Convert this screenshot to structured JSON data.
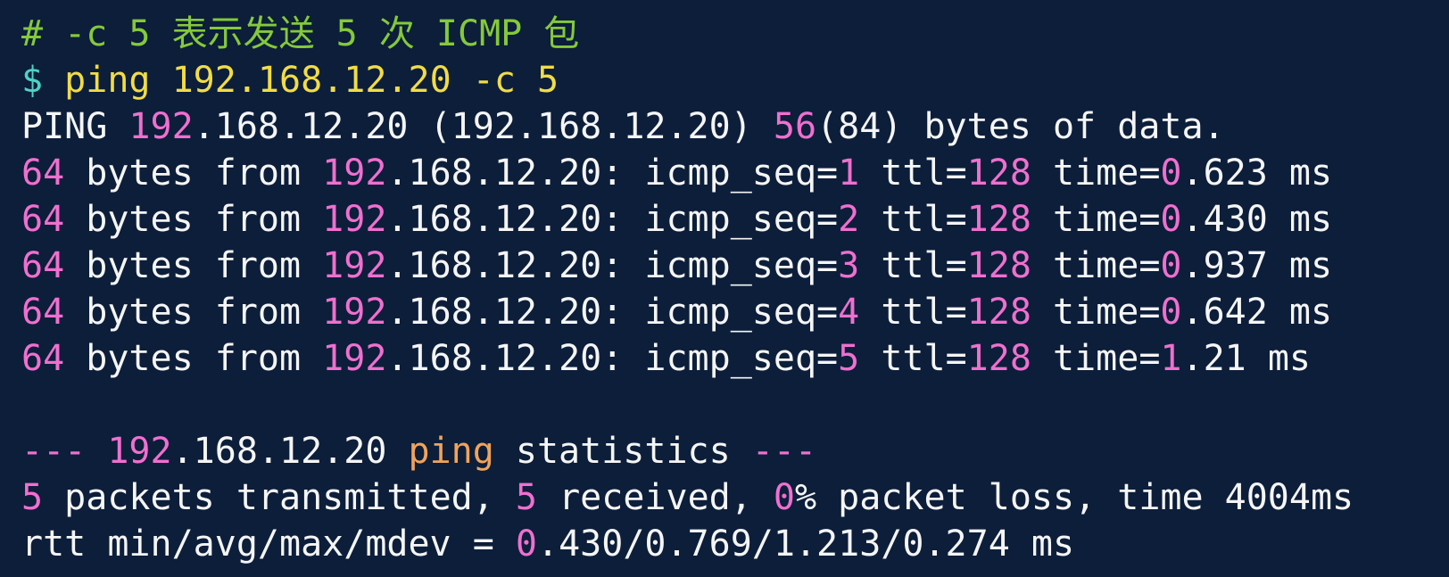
{
  "terminal": {
    "lines": [
      {
        "segments": [
          {
            "text": "# -c 5 表示发送 5 次 ICMP 包",
            "color": "green"
          }
        ]
      },
      {
        "segments": [
          {
            "text": "$ ",
            "color": "cyan"
          },
          {
            "text": "ping 192.168.12.20 -c 5",
            "color": "yellow"
          }
        ]
      },
      {
        "segments": [
          {
            "text": "PING ",
            "color": "white"
          },
          {
            "text": "192",
            "color": "pink"
          },
          {
            "text": ".168.12.20 (192.168.12.20) ",
            "color": "white"
          },
          {
            "text": "56",
            "color": "pink"
          },
          {
            "text": "(84) bytes of data.",
            "color": "white"
          }
        ]
      },
      {
        "segments": [
          {
            "text": "64",
            "color": "pink"
          },
          {
            "text": " bytes from ",
            "color": "white"
          },
          {
            "text": "192",
            "color": "pink"
          },
          {
            "text": ".168.12.20: icmp_seq=",
            "color": "white"
          },
          {
            "text": "1",
            "color": "pink"
          },
          {
            "text": " ttl=",
            "color": "white"
          },
          {
            "text": "128",
            "color": "pink"
          },
          {
            "text": " time=",
            "color": "white"
          },
          {
            "text": "0",
            "color": "pink"
          },
          {
            "text": ".623 ms",
            "color": "white"
          }
        ]
      },
      {
        "segments": [
          {
            "text": "64",
            "color": "pink"
          },
          {
            "text": " bytes from ",
            "color": "white"
          },
          {
            "text": "192",
            "color": "pink"
          },
          {
            "text": ".168.12.20: icmp_seq=",
            "color": "white"
          },
          {
            "text": "2",
            "color": "pink"
          },
          {
            "text": " ttl=",
            "color": "white"
          },
          {
            "text": "128",
            "color": "pink"
          },
          {
            "text": " time=",
            "color": "white"
          },
          {
            "text": "0",
            "color": "pink"
          },
          {
            "text": ".430 ms",
            "color": "white"
          }
        ]
      },
      {
        "segments": [
          {
            "text": "64",
            "color": "pink"
          },
          {
            "text": " bytes from ",
            "color": "white"
          },
          {
            "text": "192",
            "color": "pink"
          },
          {
            "text": ".168.12.20: icmp_seq=",
            "color": "white"
          },
          {
            "text": "3",
            "color": "pink"
          },
          {
            "text": " ttl=",
            "color": "white"
          },
          {
            "text": "128",
            "color": "pink"
          },
          {
            "text": " time=",
            "color": "white"
          },
          {
            "text": "0",
            "color": "pink"
          },
          {
            "text": ".937 ms",
            "color": "white"
          }
        ]
      },
      {
        "segments": [
          {
            "text": "64",
            "color": "pink"
          },
          {
            "text": " bytes from ",
            "color": "white"
          },
          {
            "text": "192",
            "color": "pink"
          },
          {
            "text": ".168.12.20: icmp_seq=",
            "color": "white"
          },
          {
            "text": "4",
            "color": "pink"
          },
          {
            "text": " ttl=",
            "color": "white"
          },
          {
            "text": "128",
            "color": "pink"
          },
          {
            "text": " time=",
            "color": "white"
          },
          {
            "text": "0",
            "color": "pink"
          },
          {
            "text": ".642 ms",
            "color": "white"
          }
        ]
      },
      {
        "segments": [
          {
            "text": "64",
            "color": "pink"
          },
          {
            "text": " bytes from ",
            "color": "white"
          },
          {
            "text": "192",
            "color": "pink"
          },
          {
            "text": ".168.12.20: icmp_seq=",
            "color": "white"
          },
          {
            "text": "5",
            "color": "pink"
          },
          {
            "text": " ttl=",
            "color": "white"
          },
          {
            "text": "128",
            "color": "pink"
          },
          {
            "text": " time=",
            "color": "white"
          },
          {
            "text": "1",
            "color": "pink"
          },
          {
            "text": ".21 ms",
            "color": "white"
          }
        ]
      },
      {
        "blank": true,
        "segments": []
      },
      {
        "segments": [
          {
            "text": "--- ",
            "color": "pink"
          },
          {
            "text": "192",
            "color": "pink"
          },
          {
            "text": ".168.12.20 ",
            "color": "white"
          },
          {
            "text": "ping",
            "color": "orange"
          },
          {
            "text": " statistics ",
            "color": "white"
          },
          {
            "text": "---",
            "color": "pink"
          }
        ]
      },
      {
        "segments": [
          {
            "text": "5",
            "color": "pink"
          },
          {
            "text": " packets transmitted, ",
            "color": "white"
          },
          {
            "text": "5",
            "color": "pink"
          },
          {
            "text": " received, ",
            "color": "white"
          },
          {
            "text": "0",
            "color": "pink"
          },
          {
            "text": "% packet loss, time 4004ms",
            "color": "white"
          }
        ]
      },
      {
        "segments": [
          {
            "text": "rtt min/avg/max/mdev = ",
            "color": "white"
          },
          {
            "text": "0",
            "color": "pink"
          },
          {
            "text": ".430/0.769/1.213/0.274 ms",
            "color": "white"
          }
        ]
      }
    ]
  },
  "colors": {
    "background": "#0c1e3a",
    "green": "#85c93a",
    "cyan": "#4fd1c5",
    "yellow": "#f2dc45",
    "pink": "#f06fcf",
    "orange": "#f0a35a",
    "white": "#f5f5f5"
  }
}
